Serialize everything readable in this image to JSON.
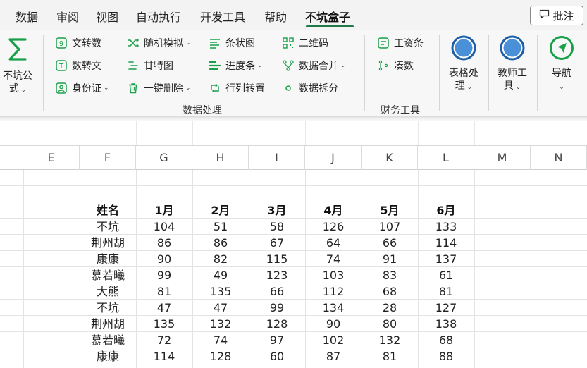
{
  "menu": {
    "tabs": [
      {
        "label": "数据"
      },
      {
        "label": "审阅"
      },
      {
        "label": "视图"
      },
      {
        "label": "自动执行"
      },
      {
        "label": "开发工具"
      },
      {
        "label": "帮助"
      },
      {
        "label": "不坑盒子"
      }
    ],
    "active_tab": "不坑盒子",
    "comment_label": "批注"
  },
  "ribbon": {
    "formula_btn": {
      "line1": "不坑公",
      "line2": "式"
    },
    "data_group": {
      "col1": [
        "文转数",
        "数转文",
        "身份证"
      ],
      "col2": [
        "随机模拟",
        "甘特图",
        "一键删除"
      ],
      "col3": [
        "条状图",
        "进度条",
        "行列转置"
      ],
      "col4": [
        "二维码",
        "数据合并",
        "数据拆分"
      ],
      "label": "数据处理"
    },
    "finance_group": {
      "items": [
        "工资条",
        "凑数"
      ],
      "label": "财务工具"
    },
    "table_btn": {
      "line1": "表格处",
      "line2": "理"
    },
    "teacher_btn": {
      "line1": "教师工",
      "line2": "具"
    },
    "nav_btn": {
      "line1": "导航"
    },
    "colors": {
      "accent_green": "#1aa04a",
      "circle_blue": "#4a90d9",
      "circle_ring": "#1e5fa8"
    }
  },
  "sheet": {
    "columns": [
      "E",
      "F",
      "G",
      "H",
      "I",
      "J",
      "K",
      "L",
      "M",
      "N"
    ],
    "headers": [
      "姓名",
      "1月",
      "2月",
      "3月",
      "4月",
      "5月",
      "6月"
    ],
    "rows": [
      [
        "不坑",
        "104",
        "51",
        "58",
        "126",
        "107",
        "133"
      ],
      [
        "荆州胡",
        "86",
        "86",
        "67",
        "64",
        "66",
        "114"
      ],
      [
        "康康",
        "90",
        "82",
        "115",
        "74",
        "91",
        "137"
      ],
      [
        "慕若曦",
        "99",
        "49",
        "123",
        "103",
        "83",
        "61"
      ],
      [
        "大熊",
        "81",
        "135",
        "66",
        "112",
        "68",
        "81"
      ],
      [
        "不坑",
        "47",
        "47",
        "99",
        "134",
        "28",
        "127"
      ],
      [
        "荆州胡",
        "135",
        "132",
        "128",
        "90",
        "80",
        "138"
      ],
      [
        "慕若曦",
        "72",
        "74",
        "97",
        "102",
        "132",
        "68"
      ],
      [
        "康康",
        "114",
        "128",
        "60",
        "87",
        "81",
        "88"
      ]
    ]
  }
}
